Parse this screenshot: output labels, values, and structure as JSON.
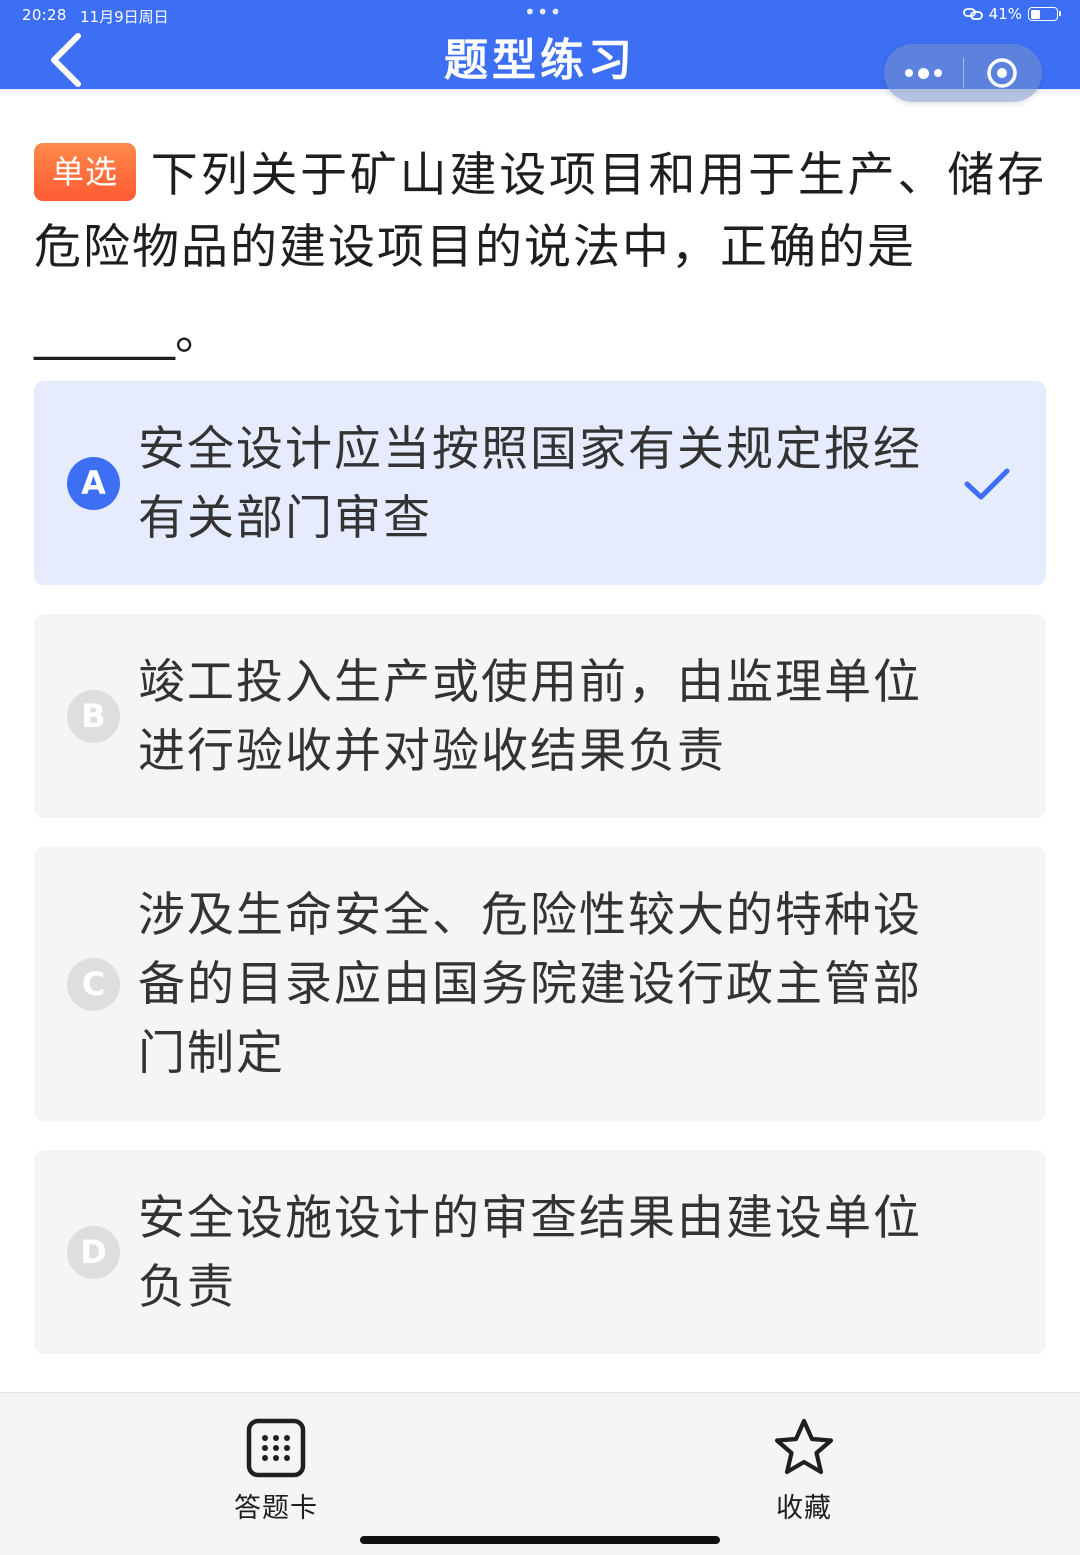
{
  "status_bar": {
    "time": "20:28",
    "date": "11月9日周日",
    "battery": "41%",
    "battery_level": 0.41
  },
  "header": {
    "title": "题型练习",
    "background_color": "#3d6ff5"
  },
  "question": {
    "type_badge": "单选",
    "text": "下列关于矿山建设项目和用于生产、储存危险物品的建设项目的说法中，正确的是",
    "blank": "______。"
  },
  "options": [
    {
      "letter": "A",
      "text": "安全设计应当按照国家有关规定报经有关部门审查",
      "selected": true
    },
    {
      "letter": "B",
      "text": "竣工投入生产或使用前，由监理单位进行验收并对验收结果负责",
      "selected": false
    },
    {
      "letter": "C",
      "text": "涉及生命安全、危险性较大的特种设备的目录应由国务院建设行政主管部门制定",
      "selected": false
    },
    {
      "letter": "D",
      "text": "安全设施设计的审查结果由建设单位负责",
      "selected": false
    }
  ],
  "bottom_bar": {
    "answer_card_label": "答题卡",
    "favorite_label": "收藏"
  },
  "icons": {
    "back": "chevron-left-icon",
    "more": "more-dots-icon",
    "close": "target-circle-icon",
    "check": "checkmark-icon",
    "answer_card": "grid-dots-icon",
    "favorite": "star-outline-icon"
  }
}
